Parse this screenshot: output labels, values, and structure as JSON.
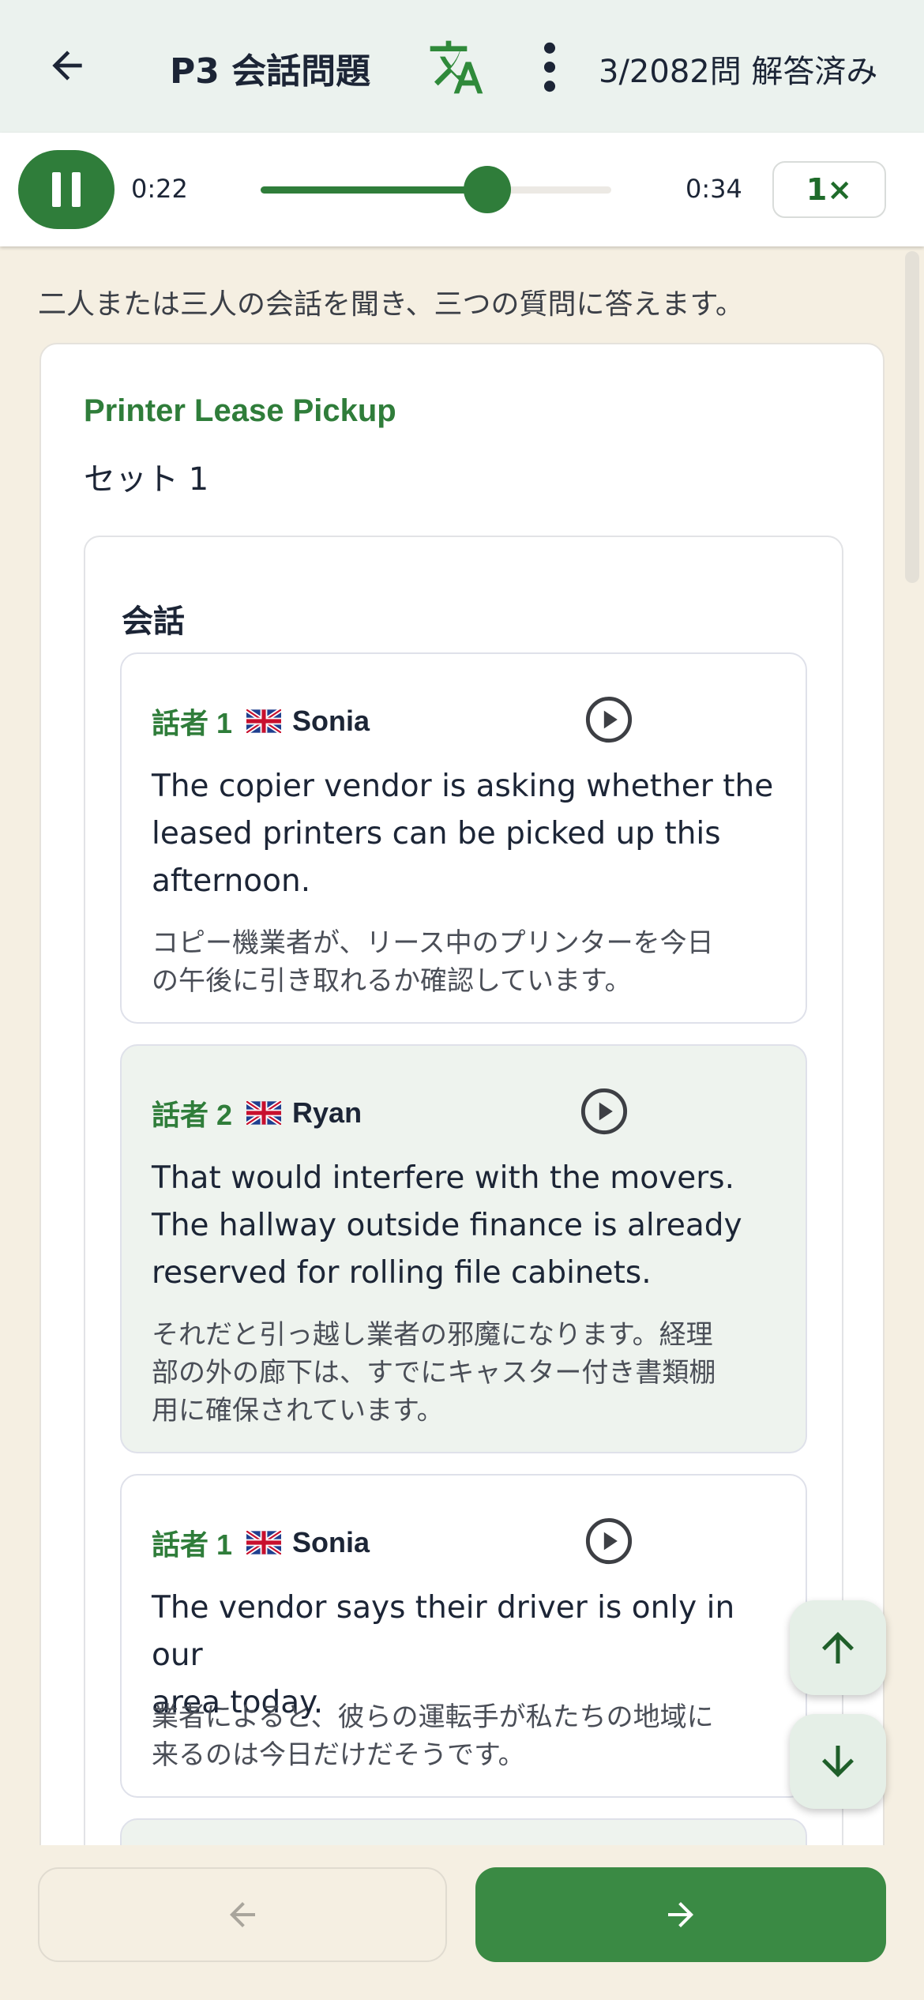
{
  "header": {
    "title": "P3 会話問題",
    "progress": "3/2082問 解答済み"
  },
  "player": {
    "current_time": "0:22",
    "total_time": "0:34",
    "progress_fraction": 0.647,
    "speed": "1×"
  },
  "instruction": "二人または三人の会話を聞き、三つの質問に答えます。",
  "card": {
    "title": "Printer Lease Pickup",
    "set_label": "セット 1",
    "conversation_heading": "会話",
    "utterances": [
      {
        "speaker_id": "話者 1",
        "name": "Sonia",
        "flag": "uk-flag-icon",
        "english": [
          "The copier vendor is asking whether the",
          "leased printers can be picked up this",
          "afternoon."
        ],
        "japanese": [
          "コピー機業者が、リース中のプリンターを今日",
          "の午後に引き取れるか確認しています。"
        ]
      },
      {
        "speaker_id": "話者 2",
        "name": "Ryan",
        "flag": "uk-flag-icon",
        "english": [
          "That would interfere with the movers.",
          "The hallway outside finance is already",
          "reserved for rolling file cabinets."
        ],
        "japanese": [
          "それだと引っ越し業者の邪魔になります。経理",
          "部の外の廊下は、すでにキャスター付き書類棚",
          "用に確保されています。"
        ]
      },
      {
        "speaker_id": "話者 1",
        "name": "Sonia",
        "flag": "uk-flag-icon",
        "english": [
          "The vendor says their driver is only in our",
          "area today."
        ],
        "japanese": [
          "業者によると、彼らの運転手が私たちの地域に",
          "来るのは今日だけだそうです。"
        ]
      }
    ]
  },
  "colors": {
    "accent": "#2f7d3a",
    "header_bg": "#ebf2ee",
    "page_bg": "#f5efe2",
    "alt_bubble_bg": "#eef3ee"
  },
  "icons": {
    "back": "arrow-left-icon",
    "translate": "translate-icon",
    "more": "more-vertical-icon",
    "pause": "pause-icon",
    "play": "play-circle-icon",
    "scroll_up": "arrow-up-icon",
    "scroll_down": "arrow-down-icon",
    "prev": "arrow-left-icon",
    "next": "arrow-right-icon"
  }
}
